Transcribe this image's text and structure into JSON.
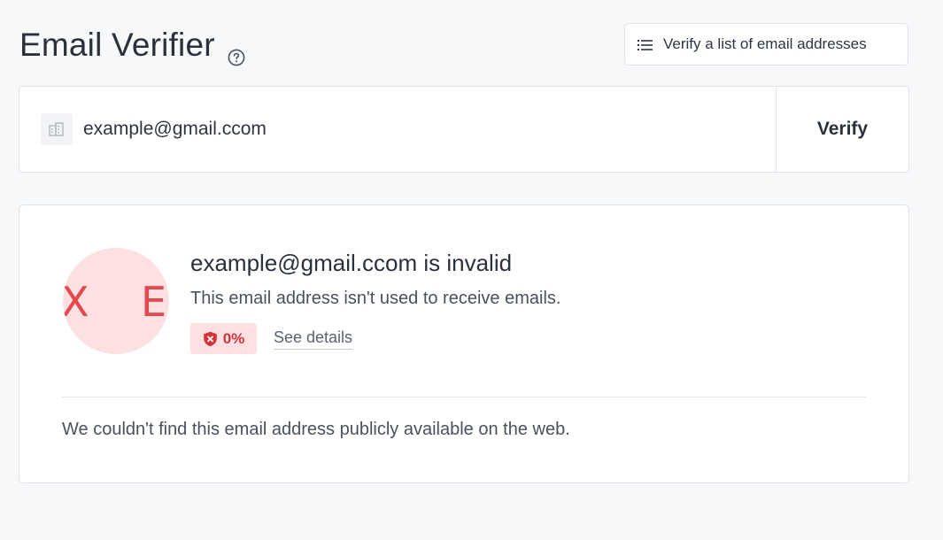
{
  "header": {
    "title": "Email Verifier",
    "help_icon": "question-circle-icon",
    "bulk_button_label": "Verify a list of email addresses",
    "bulk_button_icon": "list-icon"
  },
  "search": {
    "input_value": "example@gmail.ccom",
    "input_icon": "building-icon",
    "verify_label": "Verify"
  },
  "result": {
    "avatar_letters": [
      "X",
      "E"
    ],
    "title": "example@gmail.ccom is invalid",
    "description": "This email address isn't used to receive emails.",
    "score": "0%",
    "score_icon": "shield-x-icon",
    "details_link": "See details",
    "footer_note": "We couldn't find this email address publicly available on the web."
  },
  "colors": {
    "background": "#f7f8fa",
    "invalid_red": "#e5484d",
    "invalid_bg": "#fde1e2"
  }
}
